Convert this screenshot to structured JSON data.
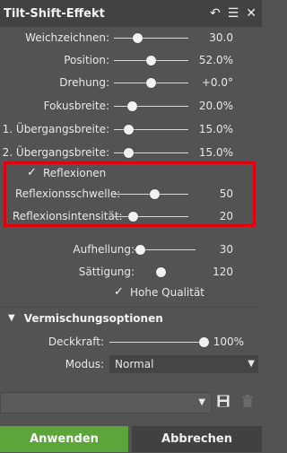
{
  "panel": {
    "title": "Tilt-Shift-Effekt",
    "icons": [
      "reset-icon",
      "menu-icon",
      "close-icon"
    ]
  },
  "sliders": [
    {
      "label": "Weichzeichnen:",
      "value": "30.0",
      "level": 0.33
    },
    {
      "label": "Position:",
      "value": "52.0%",
      "level": 0.52
    },
    {
      "label": "Drehung:",
      "value": "+0.0°",
      "level": 0.5
    },
    {
      "label": "Fokusbreite:",
      "value": "20.0%",
      "level": 0.2
    },
    {
      "label": "1. Übergangsbreite:",
      "value": "15.0%",
      "level": 0.15
    },
    {
      "label": "2. Übergangsbreite:",
      "value": "15.0%",
      "level": 0.15
    }
  ],
  "reflexionen": {
    "checkbox_label": "Reflexionen",
    "checked": true,
    "sliders": [
      {
        "label": "Reflexionsschwelle:",
        "value": "50",
        "level": 0.5
      },
      {
        "label": "Reflexionsintensität:",
        "value": "20",
        "level": 0.2
      }
    ]
  },
  "adjust": [
    {
      "label": "Aufhellung:",
      "value": "30",
      "level": 0.3
    },
    {
      "label": "Sättigung:",
      "value": "120",
      "level": 0.6
    }
  ],
  "hq": {
    "label": "Hohe Qualität",
    "checked": true
  },
  "blending": {
    "section_title": "Vermischungsoptionen",
    "opacity_label": "Deckkraft:",
    "opacity_value": "100%",
    "opacity_level": 1.0,
    "mode_label": "Modus:",
    "mode_value": "Normal"
  },
  "presets": {
    "selected": ""
  },
  "buttons": {
    "apply": "Anwenden",
    "cancel": "Abbrechen"
  },
  "colors": {
    "accent_green": "#5ba53b",
    "highlight_red": "#e2000f",
    "saturation_track": "#c0282a"
  }
}
